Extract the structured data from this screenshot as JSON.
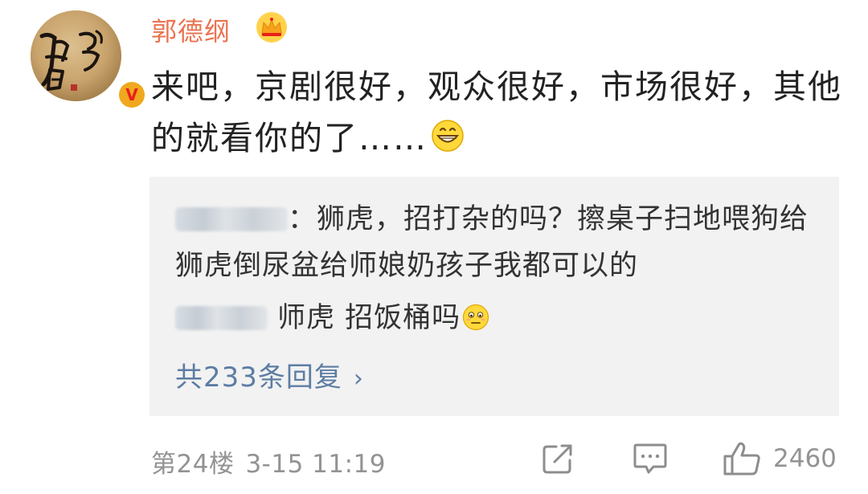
{
  "comment": {
    "author": "郭德纲",
    "avatar_text": "",
    "verified_badge": "V",
    "text": "来吧，京剧很好，观众很好，市场很好，其他的就看你的了……",
    "crown_icon": "crown-icon",
    "emoji_icon": "grin-emoji-icon"
  },
  "replies": {
    "reply1_text": "：狮虎，招打杂的吗？擦桌子扫地喂狗给狮虎倒尿盆给师娘奶孩子我都可以的",
    "reply2_text": "师虎 招饭桶吗",
    "reply2_emoji": "awkward-emoji-icon",
    "more_label": "共233条回复",
    "more_chevron": "›"
  },
  "footer": {
    "floor": "第24楼",
    "time": "3-15 11:19",
    "like_count": "2460",
    "share_icon": "share-icon",
    "reply_icon": "comment-icon",
    "like_icon": "thumbs-up-icon"
  },
  "colors": {
    "author": "#eb7350",
    "link": "#5d7da4",
    "meta": "#939393",
    "reply_bg": "#f2f2f2"
  }
}
